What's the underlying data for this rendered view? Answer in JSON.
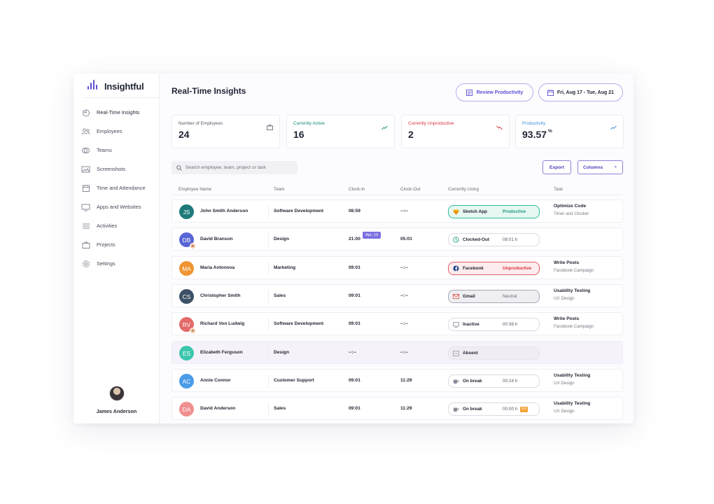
{
  "brand": {
    "name": "Insightful",
    "accent": "#5b4fd4"
  },
  "sidebar": {
    "items": [
      {
        "label": "Real-Time Insights",
        "icon": "realtime-icon",
        "active": true
      },
      {
        "label": "Employees",
        "icon": "employees-icon"
      },
      {
        "label": "Teams",
        "icon": "teams-icon"
      },
      {
        "label": "Screenshots",
        "icon": "screenshots-icon"
      },
      {
        "label": "Time and Attendance",
        "icon": "calendar-icon"
      },
      {
        "label": "Apps and Websites",
        "icon": "monitor-icon"
      },
      {
        "label": "Activities",
        "icon": "activities-icon"
      },
      {
        "label": "Projects",
        "icon": "briefcase-icon"
      },
      {
        "label": "Settings",
        "icon": "gear-icon"
      }
    ],
    "user": {
      "name": "James Anderson"
    }
  },
  "header": {
    "title": "Real-Time Insights",
    "review_label": "Review Productivity",
    "date_range": "Fri, Aug 17 - Tue, Aug 21"
  },
  "stats": [
    {
      "label": "Number of Employees",
      "value": "24",
      "icon": "briefcase-icon",
      "color": "#5a5868"
    },
    {
      "label": "Currently Active",
      "value": "16",
      "icon": "trend-up-icon",
      "color": "#16877a"
    },
    {
      "label": "Currently Unproductive",
      "value": "2",
      "icon": "trend-down-icon",
      "color": "#d8333e"
    },
    {
      "label": "Productivity",
      "value": "93.57",
      "unit": "%",
      "icon": "trend-up-icon",
      "color": "#3f8fd6"
    }
  ],
  "search": {
    "placeholder": "Search employee, team, project or task"
  },
  "toolbar": {
    "export_label": "Export",
    "columns_label": "Columns"
  },
  "table": {
    "columns": [
      "Employee Name",
      "Team",
      "Clock-In",
      "Clock-Out",
      "Currenlty Using",
      "Task"
    ],
    "rows": [
      {
        "initials": "JS",
        "color": "#1f7a7a",
        "name": "John Smith Anderson",
        "team": "Software Development",
        "clock_in": "08:59",
        "clock_out": "--:--",
        "app": "Sketch App",
        "app_icon": "sketch-icon",
        "state": "productive",
        "status": "Productive",
        "task": "Optimize Code",
        "project": "Timer and Clocker"
      },
      {
        "initials": "DB",
        "color": "#5865d6",
        "badge": "P",
        "name": "David Branson",
        "team": "Design",
        "clock_in": "21:00",
        "clock_in_date": "Apr, 15",
        "clock_out": "05:01",
        "app": "Clocked-Out",
        "app_icon": "clock-icon",
        "state": "idle",
        "status": "08:01 h",
        "task": "",
        "project": ""
      },
      {
        "initials": "MA",
        "color": "#ef9431",
        "name": "Maria Antonova",
        "team": "Marketing",
        "clock_in": "09:01",
        "clock_out": "--:--",
        "app": "Facebook",
        "app_icon": "facebook-icon",
        "state": "unproductive",
        "status": "Unproductive",
        "task": "Write Posts",
        "project": "Facebook Campaign"
      },
      {
        "initials": "CS",
        "color": "#3d5166",
        "name": "Christopher Smith",
        "team": "Sales",
        "clock_in": "09:01",
        "clock_out": "--:--",
        "app": "Gmail",
        "app_icon": "gmail-icon",
        "state": "neutral",
        "status": "Neutral",
        "task": "Usability Testing",
        "project": "UX Design"
      },
      {
        "initials": "RV",
        "color": "#e36a6a",
        "badge": "P",
        "name": "Richard Von Ludwig",
        "team": "Software Development",
        "clock_in": "09:01",
        "clock_out": "--:--",
        "app": "Inactive",
        "app_icon": "inactive-icon",
        "state": "idle",
        "status": "00:36 h",
        "task": "Write Posts",
        "project": "Facebook Campaign"
      },
      {
        "initials": "ES",
        "color": "#3cc6ad",
        "name": "Elizabeth Ferguson",
        "team": "Design",
        "clock_in": "--:--",
        "clock_out": "--:--",
        "app": "Absent",
        "app_icon": "absent-icon",
        "state": "absent",
        "status": "",
        "task": "",
        "project": "",
        "muted": true
      },
      {
        "initials": "AC",
        "color": "#4a9be8",
        "name": "Annie Connor",
        "team": "Customer Support",
        "clock_in": "09:01",
        "clock_out": "11:29",
        "app": "On break",
        "app_icon": "coffee-icon",
        "state": "idle",
        "status": "00:24 h",
        "task": "Usability Testing",
        "project": "UX Design"
      },
      {
        "initials": "DA",
        "color": "#f08f8f",
        "name": "David Anderson",
        "team": "Sales",
        "clock_in": "09:01",
        "clock_out": "11:29",
        "app": "On break",
        "app_icon": "coffee-icon",
        "state": "idle",
        "status": "00:00 h",
        "tag": "1/3",
        "task": "Usability Testing",
        "project": "UX Design"
      }
    ]
  }
}
